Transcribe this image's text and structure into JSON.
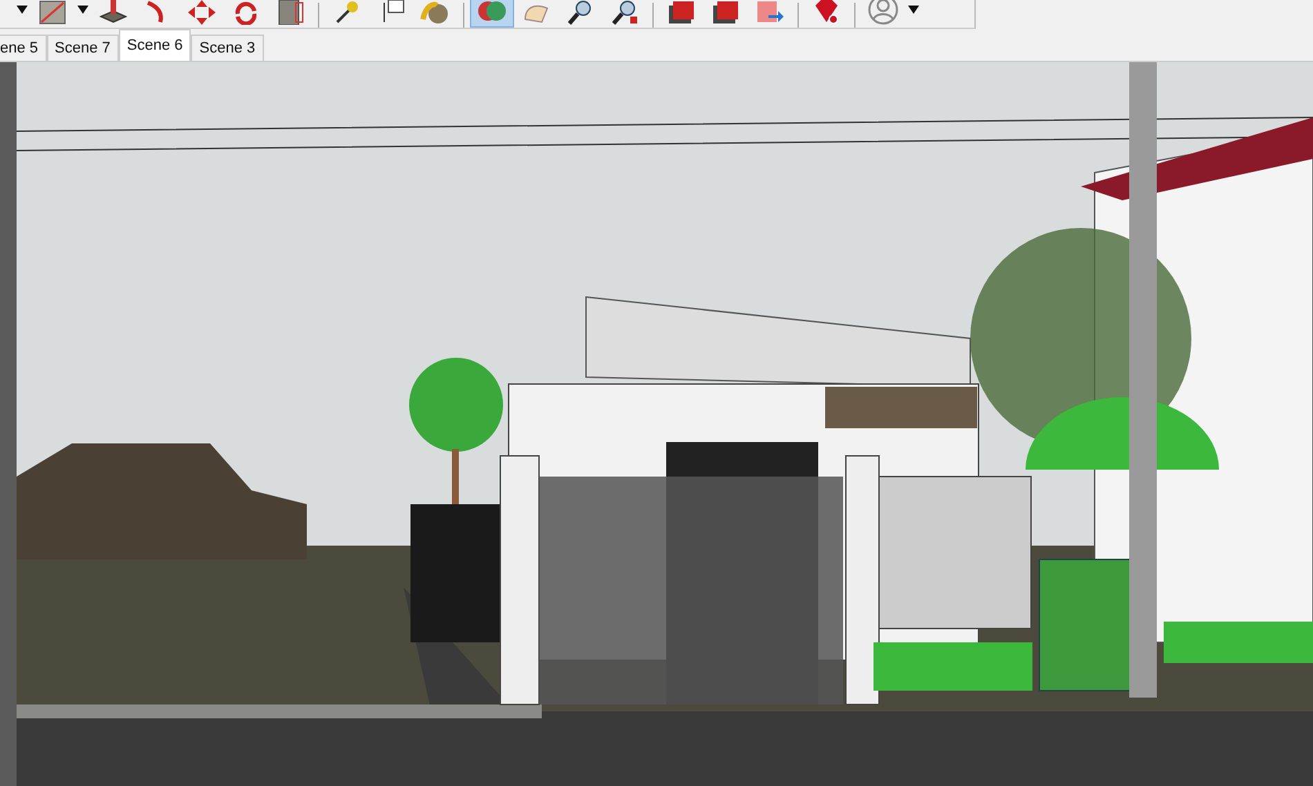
{
  "toolbar": {
    "tools": [
      {
        "selected": false
      },
      {
        "selected": false
      },
      {
        "selected": false
      },
      {
        "selected": false
      },
      {
        "selected": false
      },
      {
        "selected": false
      },
      {
        "selected": false
      },
      {
        "selected": false
      },
      {
        "selected": false
      },
      {
        "selected": false
      },
      {
        "selected": false
      },
      {
        "selected": true
      },
      {
        "selected": false
      },
      {
        "selected": false
      },
      {
        "selected": false
      },
      {
        "selected": false
      },
      {
        "selected": false
      },
      {
        "selected": false
      },
      {
        "selected": false
      },
      {
        "selected": false
      },
      {
        "selected": false
      }
    ]
  },
  "scene_tabs": [
    {
      "label": "ene 5",
      "selected": false
    },
    {
      "label": "Scene 7",
      "selected": false
    },
    {
      "label": "Scene 6",
      "selected": true
    },
    {
      "label": "Scene 3",
      "selected": false
    }
  ]
}
